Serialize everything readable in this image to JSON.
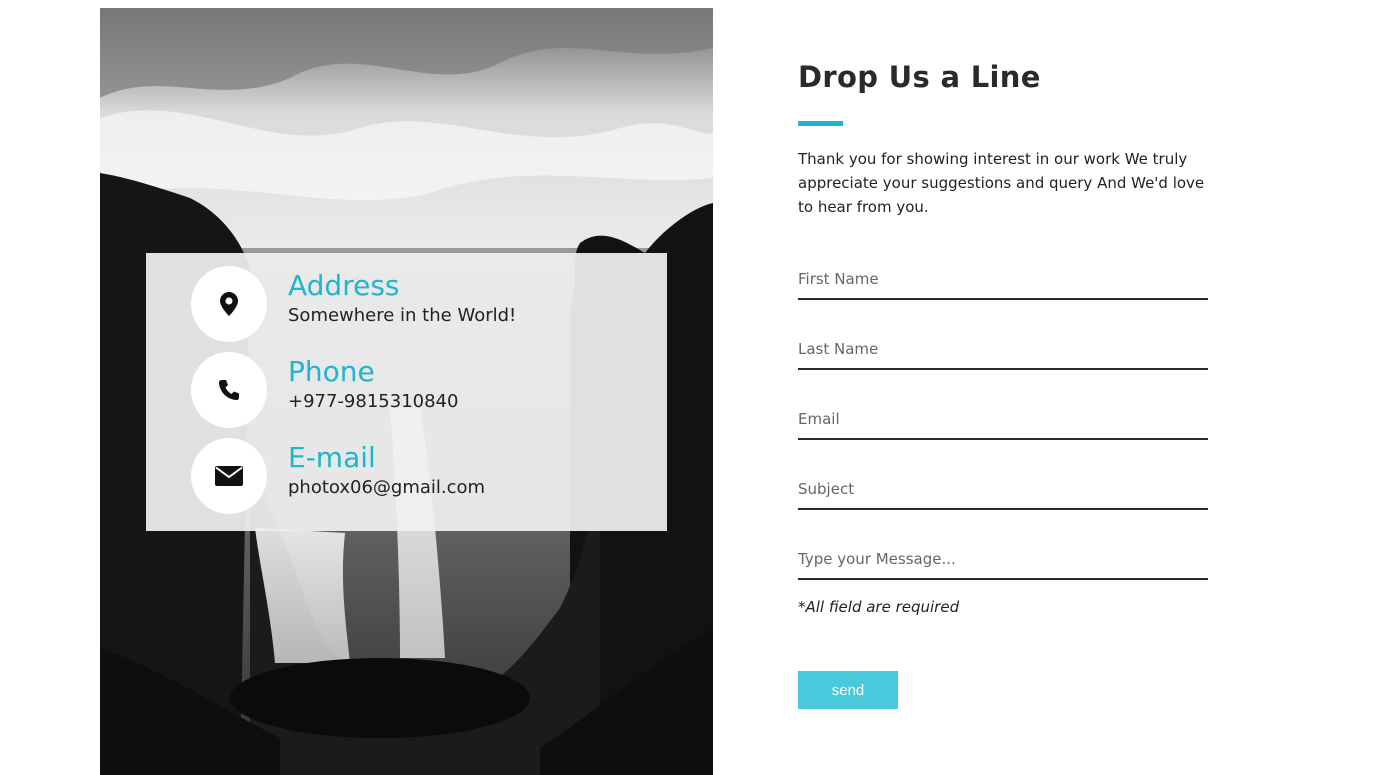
{
  "contact_info": [
    {
      "icon": "map-pin-icon",
      "title": "Address",
      "value": "Somewhere in the World!"
    },
    {
      "icon": "phone-icon",
      "title": "Phone",
      "value": "+977-9815310840"
    },
    {
      "icon": "envelope-icon",
      "title": "E-mail",
      "value": "photox06@gmail.com"
    }
  ],
  "form": {
    "heading": "Drop Us a Line",
    "intro": "Thank you for showing interest in our work We truly appreciate your suggestions and query And We'd love to hear from you.",
    "fields": {
      "first_name_placeholder": "First Name",
      "last_name_placeholder": "Last Name",
      "email_placeholder": "Email",
      "subject_placeholder": "Subject",
      "message_placeholder": "Type your Message..."
    },
    "required_note": "*All field are required",
    "send_label": "send"
  },
  "colors": {
    "accent": "#1fb5cc",
    "button": "#4ac8dc",
    "heading": "#2a2a2a"
  }
}
